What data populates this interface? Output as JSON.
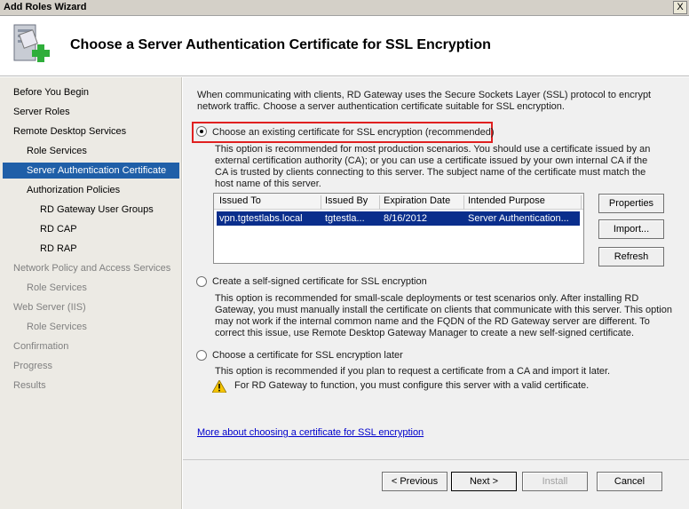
{
  "window": {
    "title": "Add Roles Wizard",
    "close_label": "X"
  },
  "header": {
    "heading": "Choose a Server Authentication Certificate for SSL Encryption",
    "icon": "server-add-icon"
  },
  "nav": {
    "items": [
      {
        "label": "Before You Begin",
        "state": "done"
      },
      {
        "label": "Server Roles",
        "state": "done"
      },
      {
        "label": "Remote Desktop Services",
        "state": "done"
      },
      {
        "label": "Role Services",
        "state": "done"
      },
      {
        "label": "Server Authentication Certificate",
        "state": "selected"
      },
      {
        "label": "Authorization Policies",
        "state": "done"
      },
      {
        "label": "RD Gateway User Groups",
        "state": "done"
      },
      {
        "label": "RD CAP",
        "state": "done"
      },
      {
        "label": "RD RAP",
        "state": "done"
      },
      {
        "label": "Network Policy and Access Services",
        "state": "disabled"
      },
      {
        "label": "Role Services",
        "state": "disabled"
      },
      {
        "label": "Web Server (IIS)",
        "state": "disabled"
      },
      {
        "label": "Role Services",
        "state": "disabled"
      },
      {
        "label": "Confirmation",
        "state": "disabled"
      },
      {
        "label": "Progress",
        "state": "disabled"
      },
      {
        "label": "Results",
        "state": "disabled"
      }
    ]
  },
  "content": {
    "intro": "When communicating with clients, RD Gateway uses the Secure Sockets Layer (SSL) protocol to encrypt network traffic. Choose a server authentication certificate suitable for SSL encryption.",
    "options": [
      {
        "label": "Choose an existing certificate for SSL encryption (recommended)",
        "selected": true,
        "description": "This option is recommended for most production scenarios. You should use a certificate issued by an external certification authority (CA); or you can use a certificate issued by your own internal CA if the CA is trusted by clients connecting to this server. The subject name of the certificate must match the host name of this server."
      },
      {
        "label": "Create a self-signed certificate for SSL encryption",
        "selected": false,
        "description": "This option is recommended for small-scale deployments or test scenarios only. After installing RD Gateway, you must manually install the certificate on clients that communicate with this server. This option may not work if the internal common name and the FQDN of the RD Gateway server are different. To correct this issue, use Remote Desktop Gateway Manager to create a new self-signed certificate."
      },
      {
        "label": "Choose a certificate for SSL encryption later",
        "selected": false,
        "description": "This option is recommended if you plan to request a certificate from a CA and import it later.",
        "warning": "For RD Gateway to function, you must configure this server with a valid certificate."
      }
    ],
    "table": {
      "columns": [
        "Issued To",
        "Issued By",
        "Expiration Date",
        "Intended Purpose"
      ],
      "rows": [
        [
          "vpn.tgtestlabs.local",
          "tgtestla...",
          "8/16/2012",
          "Server Authentication..."
        ]
      ]
    },
    "side_buttons": {
      "properties": "Properties",
      "import": "Import...",
      "refresh": "Refresh"
    },
    "link": "More about choosing a certificate for SSL encryption"
  },
  "footer": {
    "previous": "< Previous",
    "next": "Next >",
    "install": "Install",
    "cancel": "Cancel"
  },
  "colors": {
    "selection": "#0a2e8c",
    "nav_selected": "#1f5fa8",
    "highlight": "#e02020",
    "link": "#0000cc"
  }
}
